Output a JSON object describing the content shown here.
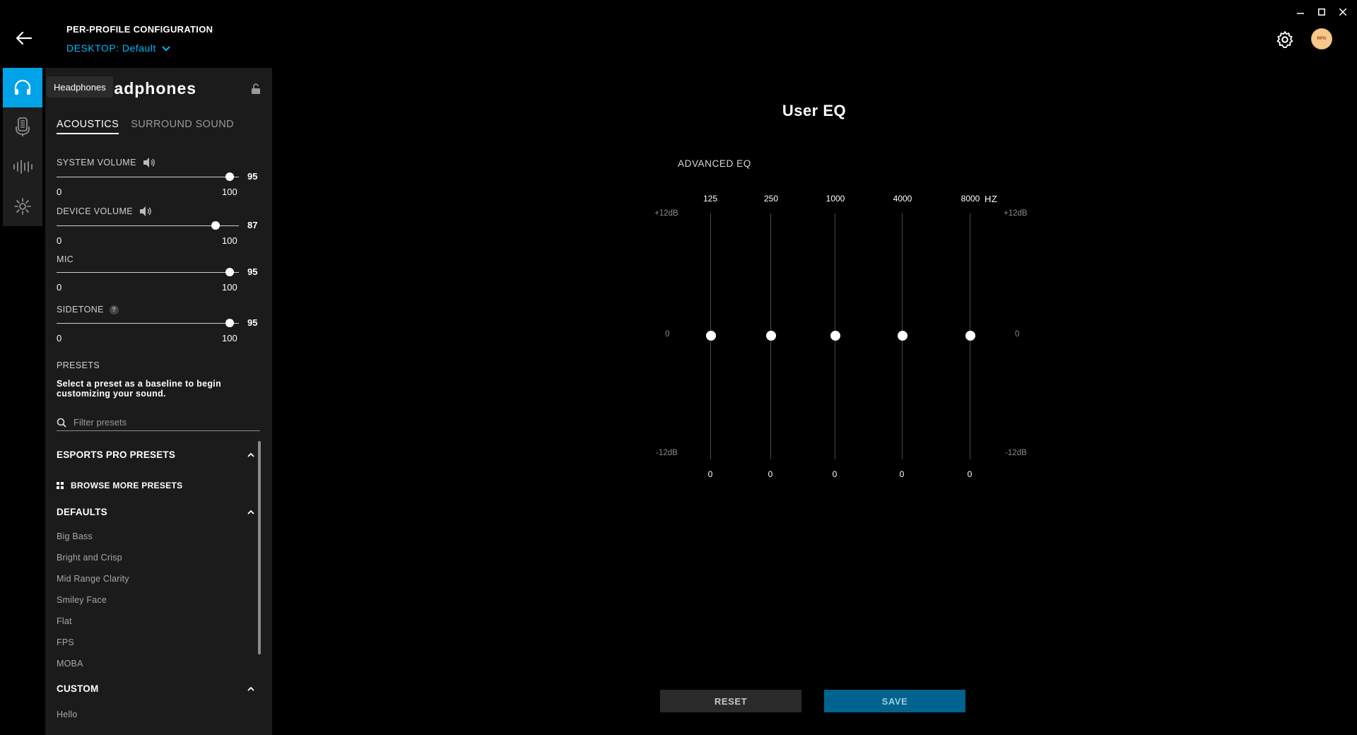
{
  "header": {
    "config_title": "PER-PROFILE CONFIGURATION",
    "profile": "DESKTOP: Default"
  },
  "window_controls": {
    "minimize_icon": "minimize-icon",
    "maximize_icon": "maximize-icon",
    "close_icon": "close-icon"
  },
  "avatar_text": "RPG",
  "rail": {
    "items": [
      {
        "name": "headphones",
        "icon": "headphones-icon",
        "active": true
      },
      {
        "name": "microphone",
        "icon": "microphone-icon",
        "active": false
      },
      {
        "name": "equalizer",
        "icon": "waveform-icon",
        "active": false
      },
      {
        "name": "lighting",
        "icon": "lighting-icon",
        "active": false
      }
    ],
    "tooltip": "Headphones"
  },
  "panel": {
    "title": "Headphones",
    "tabs": [
      "ACOUSTICS",
      "SURROUND SOUND"
    ],
    "active_tab": 0,
    "sliders": [
      {
        "label": "SYSTEM VOLUME",
        "value": "95",
        "min": "0",
        "max": "100",
        "icon": "speaker-icon"
      },
      {
        "label": "DEVICE VOLUME",
        "value": "87",
        "min": "0",
        "max": "100",
        "icon": "speaker-icon"
      },
      {
        "label": "MIC",
        "value": "95",
        "min": "0",
        "max": "100"
      },
      {
        "label": "SIDETONE",
        "value": "95",
        "min": "0",
        "max": "100",
        "help": "?"
      }
    ],
    "presets_label": "PRESETS",
    "presets_desc": "Select a preset as a baseline to begin customizing your sound.",
    "filter_placeholder": "Filter presets",
    "esports_section": "ESPORTS PRO PRESETS",
    "browse_more": "BROWSE MORE PRESETS",
    "defaults_section": "DEFAULTS",
    "defaults": [
      "Big Bass",
      "Bright and Crisp",
      "Mid Range Clarity",
      "Smiley Face",
      "Flat",
      "FPS",
      "MOBA"
    ],
    "custom_section": "CUSTOM",
    "custom": [
      "Hello"
    ]
  },
  "eq": {
    "title": "User EQ",
    "subtitle": "ADVANCED EQ",
    "unit": "HZ",
    "top_label": "+12dB",
    "mid_label": "0",
    "bottom_label": "-12dB",
    "bands": [
      {
        "freq": "125",
        "value": "0"
      },
      {
        "freq": "250",
        "value": "0"
      },
      {
        "freq": "1000",
        "value": "0"
      },
      {
        "freq": "4000",
        "value": "0"
      },
      {
        "freq": "8000",
        "value": "0"
      }
    ]
  },
  "buttons": {
    "reset": "RESET",
    "save": "SAVE"
  }
}
